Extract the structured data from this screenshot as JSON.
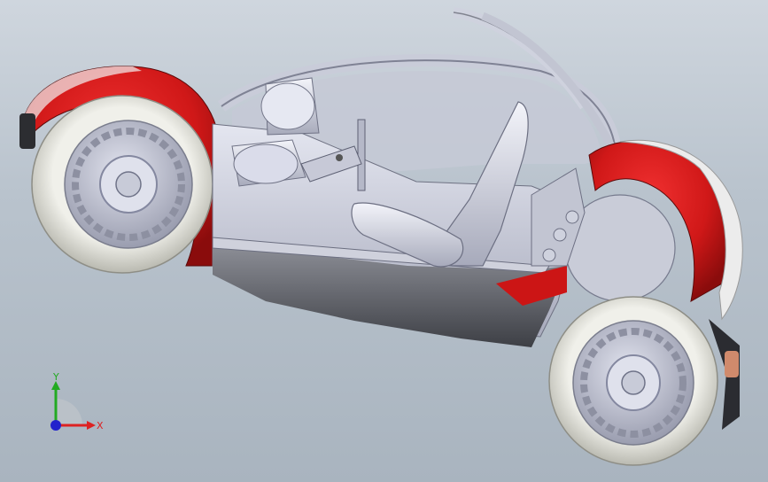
{
  "viewport": {
    "background_top": "#cfd6de",
    "background_bottom": "#a9b4bf"
  },
  "model": {
    "body_color": "#d4d6e2",
    "fender_color": "#d81a1a",
    "tire_color": "#e6e6e0",
    "rim_color": "#c3c7d6"
  },
  "triad": {
    "y_label": "Y",
    "x_label": "X",
    "y_color": "#22aa22",
    "x_color": "#dd2222",
    "z_color": "#2222cc"
  }
}
